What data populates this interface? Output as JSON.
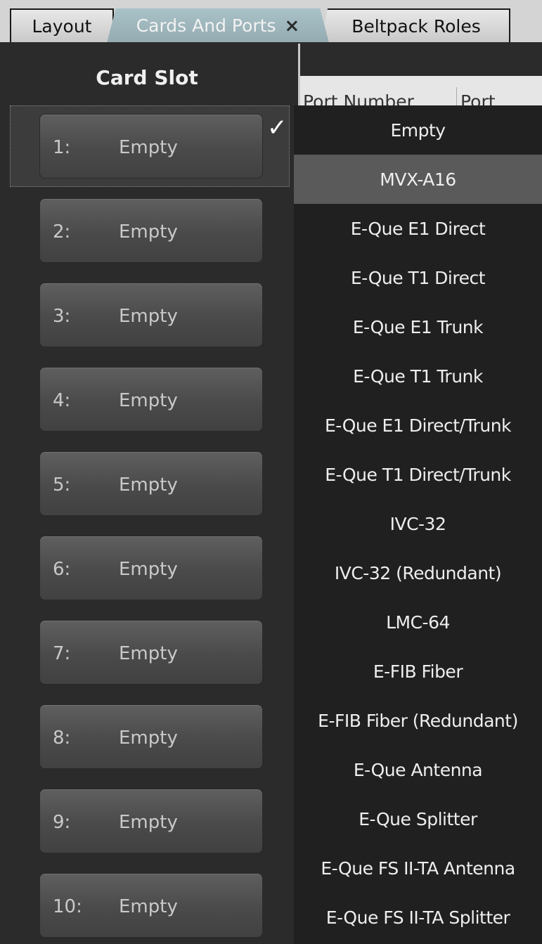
{
  "tabs": [
    {
      "label": "Layout"
    },
    {
      "label": "Cards And Ports",
      "active": true
    },
    {
      "label": "Beltpack Roles"
    }
  ],
  "close_glyph": "×",
  "left_panel": {
    "header": "Card Slot",
    "check_glyph": "✓",
    "slots": [
      {
        "num": "1:",
        "value": "Empty"
      },
      {
        "num": "2:",
        "value": "Empty"
      },
      {
        "num": "3:",
        "value": "Empty"
      },
      {
        "num": "4:",
        "value": "Empty"
      },
      {
        "num": "5:",
        "value": "Empty"
      },
      {
        "num": "6:",
        "value": "Empty"
      },
      {
        "num": "7:",
        "value": "Empty"
      },
      {
        "num": "8:",
        "value": "Empty"
      },
      {
        "num": "9:",
        "value": "Empty"
      },
      {
        "num": "10:",
        "value": "Empty"
      }
    ]
  },
  "table_header": {
    "col1": "Port Number",
    "col2": "Port Function"
  },
  "dropdown": {
    "highlighted": "MVX-A16",
    "options": [
      "Empty",
      "MVX-A16",
      "E-Que E1 Direct",
      "E-Que T1 Direct",
      "E-Que E1 Trunk",
      "E-Que T1 Trunk",
      "E-Que E1 Direct/Trunk",
      "E-Que T1 Direct/Trunk",
      "IVC-32",
      "IVC-32 (Redundant)",
      "LMC-64",
      "E-FIB Fiber",
      "E-FIB Fiber (Redundant)",
      "E-Que Antenna",
      "E-Que Splitter",
      "E-Que FS II-TA Antenna",
      "E-Que FS II-TA Splitter"
    ]
  }
}
